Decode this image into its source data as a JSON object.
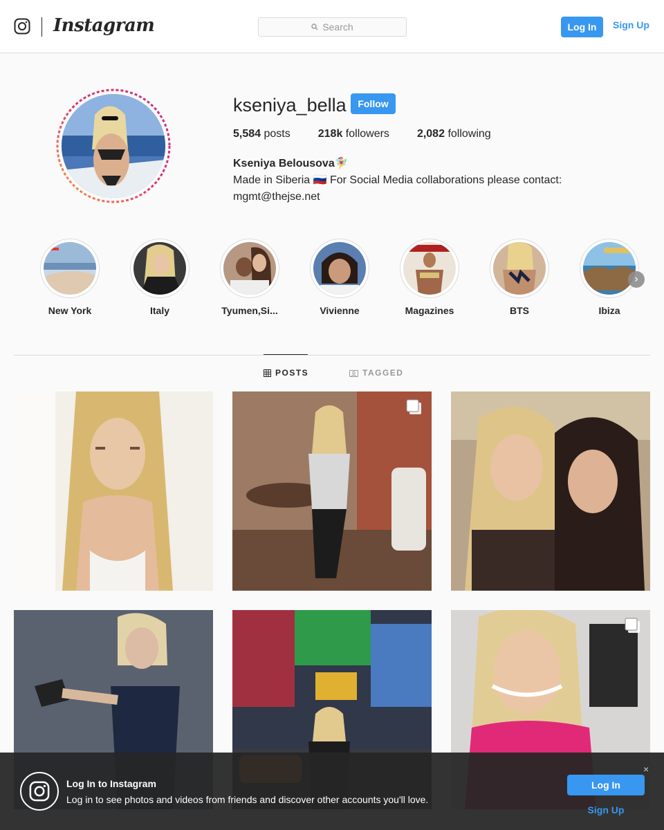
{
  "header": {
    "wordmark": "Instagram",
    "search_placeholder": "Search",
    "login_label": "Log In",
    "signup_label": "Sign Up"
  },
  "profile": {
    "username": "kseniya_bella",
    "follow_label": "Follow",
    "stats": {
      "posts_count": "5,584",
      "posts_label": "posts",
      "followers_count": "218k",
      "followers_label": "followers",
      "following_count": "2,082",
      "following_label": "following"
    },
    "full_name": "Kseniya Belousova🧚‍♀️",
    "bio_line1": "Made in Siberia 🇷🇺 For Social Media collaborations please contact:",
    "bio_line2": "mgmt@thejse.net"
  },
  "highlights": [
    {
      "label": "New York",
      "icon": "highlight-image"
    },
    {
      "label": "Italy",
      "icon": "highlight-image"
    },
    {
      "label": "Tyumen,Si...",
      "icon": "highlight-image"
    },
    {
      "label": "Vivienne",
      "icon": "highlight-image"
    },
    {
      "label": "Magazines",
      "icon": "highlight-image"
    },
    {
      "label": "BTS",
      "icon": "highlight-image"
    },
    {
      "label": "Ibiza",
      "icon": "highlight-image"
    }
  ],
  "tabs": {
    "posts_label": "POSTS",
    "tagged_label": "TAGGED",
    "active": "posts"
  },
  "colors": {
    "accent": "#3897f0",
    "text": "#262626",
    "border": "#dbdbdb"
  },
  "banner": {
    "title": "Log In to Instagram",
    "text": "Log in to see photos and videos from friends and discover other accounts you'll love.",
    "login_label": "Log In",
    "signup_label": "Sign Up",
    "close_glyph": "×"
  }
}
